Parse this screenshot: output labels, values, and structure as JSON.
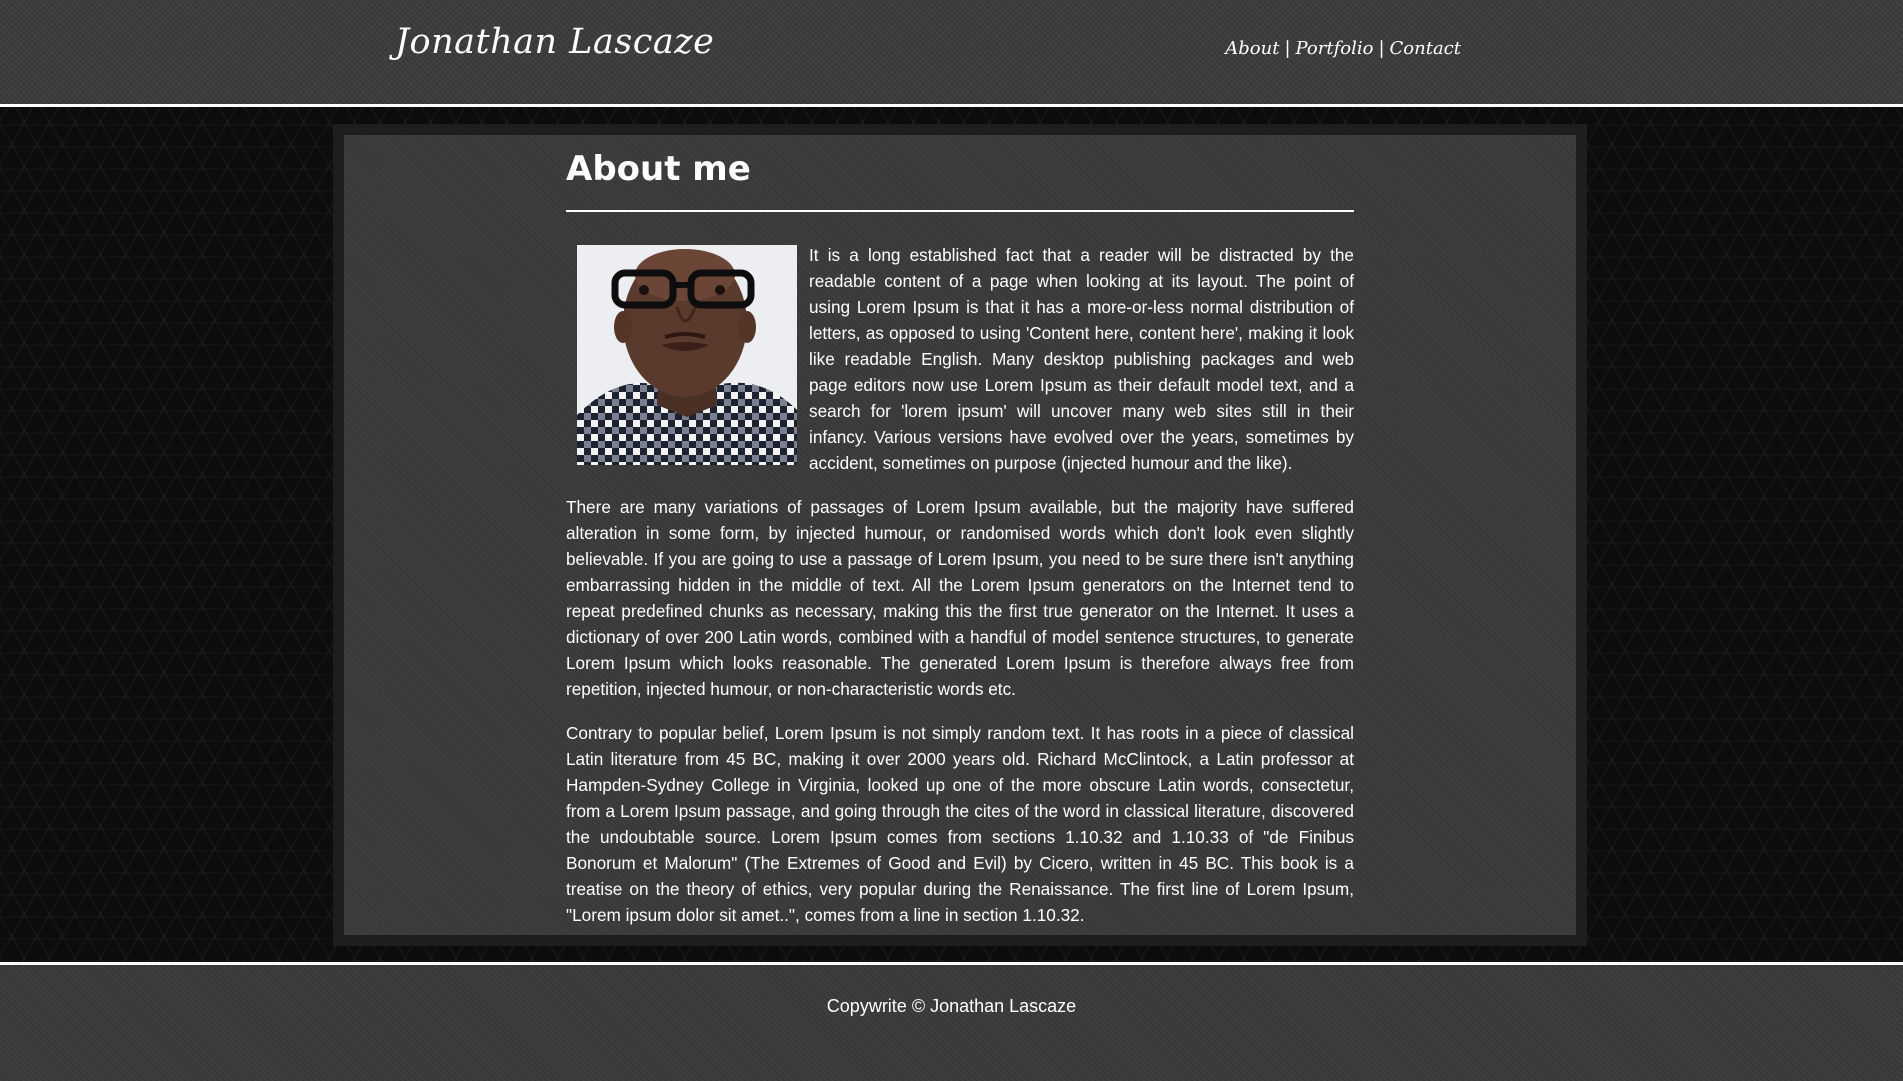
{
  "header": {
    "logo": "Jonathan Lascaze",
    "nav": [
      {
        "label": "About"
      },
      {
        "label": "Portfolio"
      },
      {
        "label": "Contact"
      }
    ],
    "separator": "|"
  },
  "main": {
    "title": "About me",
    "photo_icon": "portrait-photo",
    "paragraphs": [
      "It is a long established fact that a reader will be distracted by the readable content of a page when looking at its layout. The point of using Lorem Ipsum is that it has a more-or-less normal distribution of letters, as opposed to using 'Content here, content here', making it look like readable English. Many desktop publishing packages and web page editors now use Lorem Ipsum as their default model text, and a search for 'lorem ipsum' will uncover many web sites still in their infancy. Various versions have evolved over the years, sometimes by accident, sometimes on purpose (injected humour and the like).",
      "There are many variations of passages of Lorem Ipsum available, but the majority have suffered alteration in some form, by injected humour, or randomised words which don't look even slightly believable. If you are going to use a passage of Lorem Ipsum, you need to be sure there isn't anything embarrassing hidden in the middle of text. All the Lorem Ipsum generators on the Internet tend to repeat predefined chunks as necessary, making this the first true generator on the Internet. It uses a dictionary of over 200 Latin words, combined with a handful of model sentence structures, to generate Lorem Ipsum which looks reasonable. The generated Lorem Ipsum is therefore always free from repetition, injected humour, or non-characteristic words etc.",
      "Contrary to popular belief, Lorem Ipsum is not simply random text. It has roots in a piece of classical Latin literature from 45 BC, making it over 2000 years old. Richard McClintock, a Latin professor at Hampden-Sydney College in Virginia, looked up one of the more obscure Latin words, consectetur, from a Lorem Ipsum passage, and going through the cites of the word in classical literature, discovered the undoubtable source. Lorem Ipsum comes from sections 1.10.32 and 1.10.33 of \"de Finibus Bonorum et Malorum\" (The Extremes of Good and Evil) by Cicero, written in 45 BC. This book is a treatise on the theory of ethics, very popular during the Renaissance. The first line of Lorem Ipsum, \"Lorem ipsum dolor sit amet..\", comes from a line in section 1.10.32."
    ]
  },
  "footer": {
    "copyright": "Copywrite © Jonathan Lascaze"
  }
}
